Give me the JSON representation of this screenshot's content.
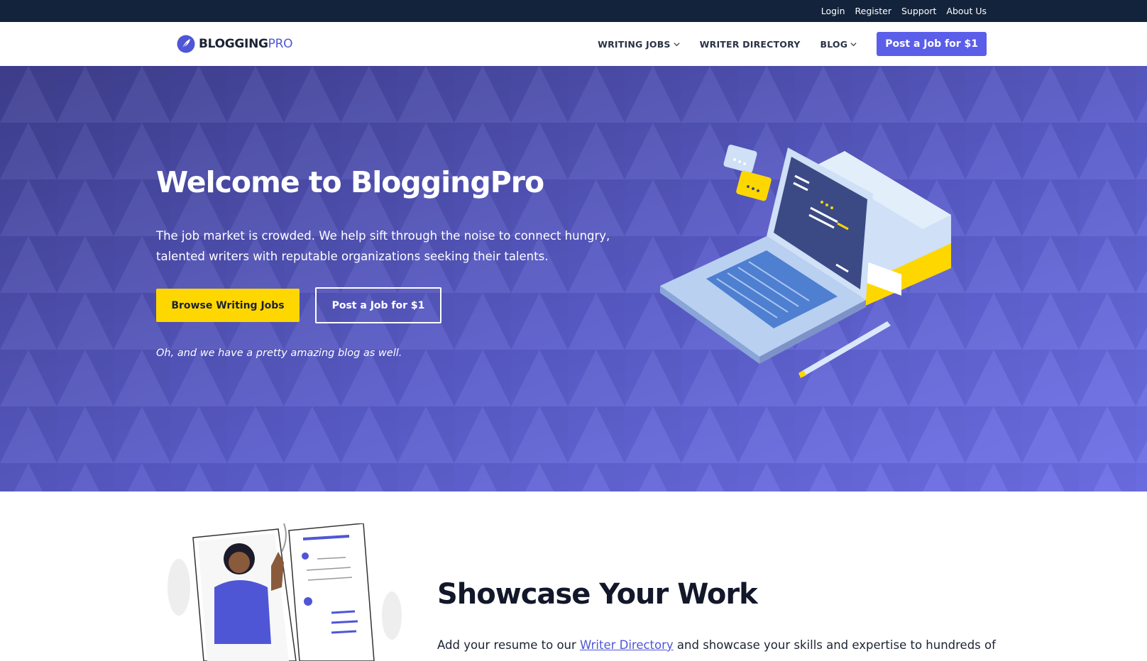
{
  "topbar": {
    "links": [
      "Login",
      "Register",
      "Support",
      "About Us"
    ]
  },
  "header": {
    "logo_main": "BLOGGING",
    "logo_accent": "PRO",
    "nav": {
      "writing_jobs": "WRITING JOBS",
      "writer_directory": "WRITER DIRECTORY",
      "blog": "BLOG"
    },
    "cta": "Post a Job for $1"
  },
  "hero": {
    "title": "Welcome to BloggingPro",
    "subtitle": "The job market is crowded. We help sift through the noise to connect hungry, talented writers with reputable organizations seeking their talents.",
    "browse_button": "Browse Writing Jobs",
    "post_button": "Post a Job for $1",
    "note": "Oh, and we have a pretty amazing blog as well."
  },
  "showcase": {
    "title": "Showcase Your Work",
    "text_before": "Add your resume to our ",
    "link": "Writer Directory",
    "text_after": " and showcase your skills and expertise to hundreds of"
  },
  "colors": {
    "topbar": "#12233b",
    "accent": "#5a5ee8",
    "yellow": "#ffd700",
    "hero_bg": "#5c5fd2"
  },
  "icons": [
    "feather-logo-icon",
    "chevron-down-icon",
    "laptop-illustration",
    "resume-illustration"
  ]
}
